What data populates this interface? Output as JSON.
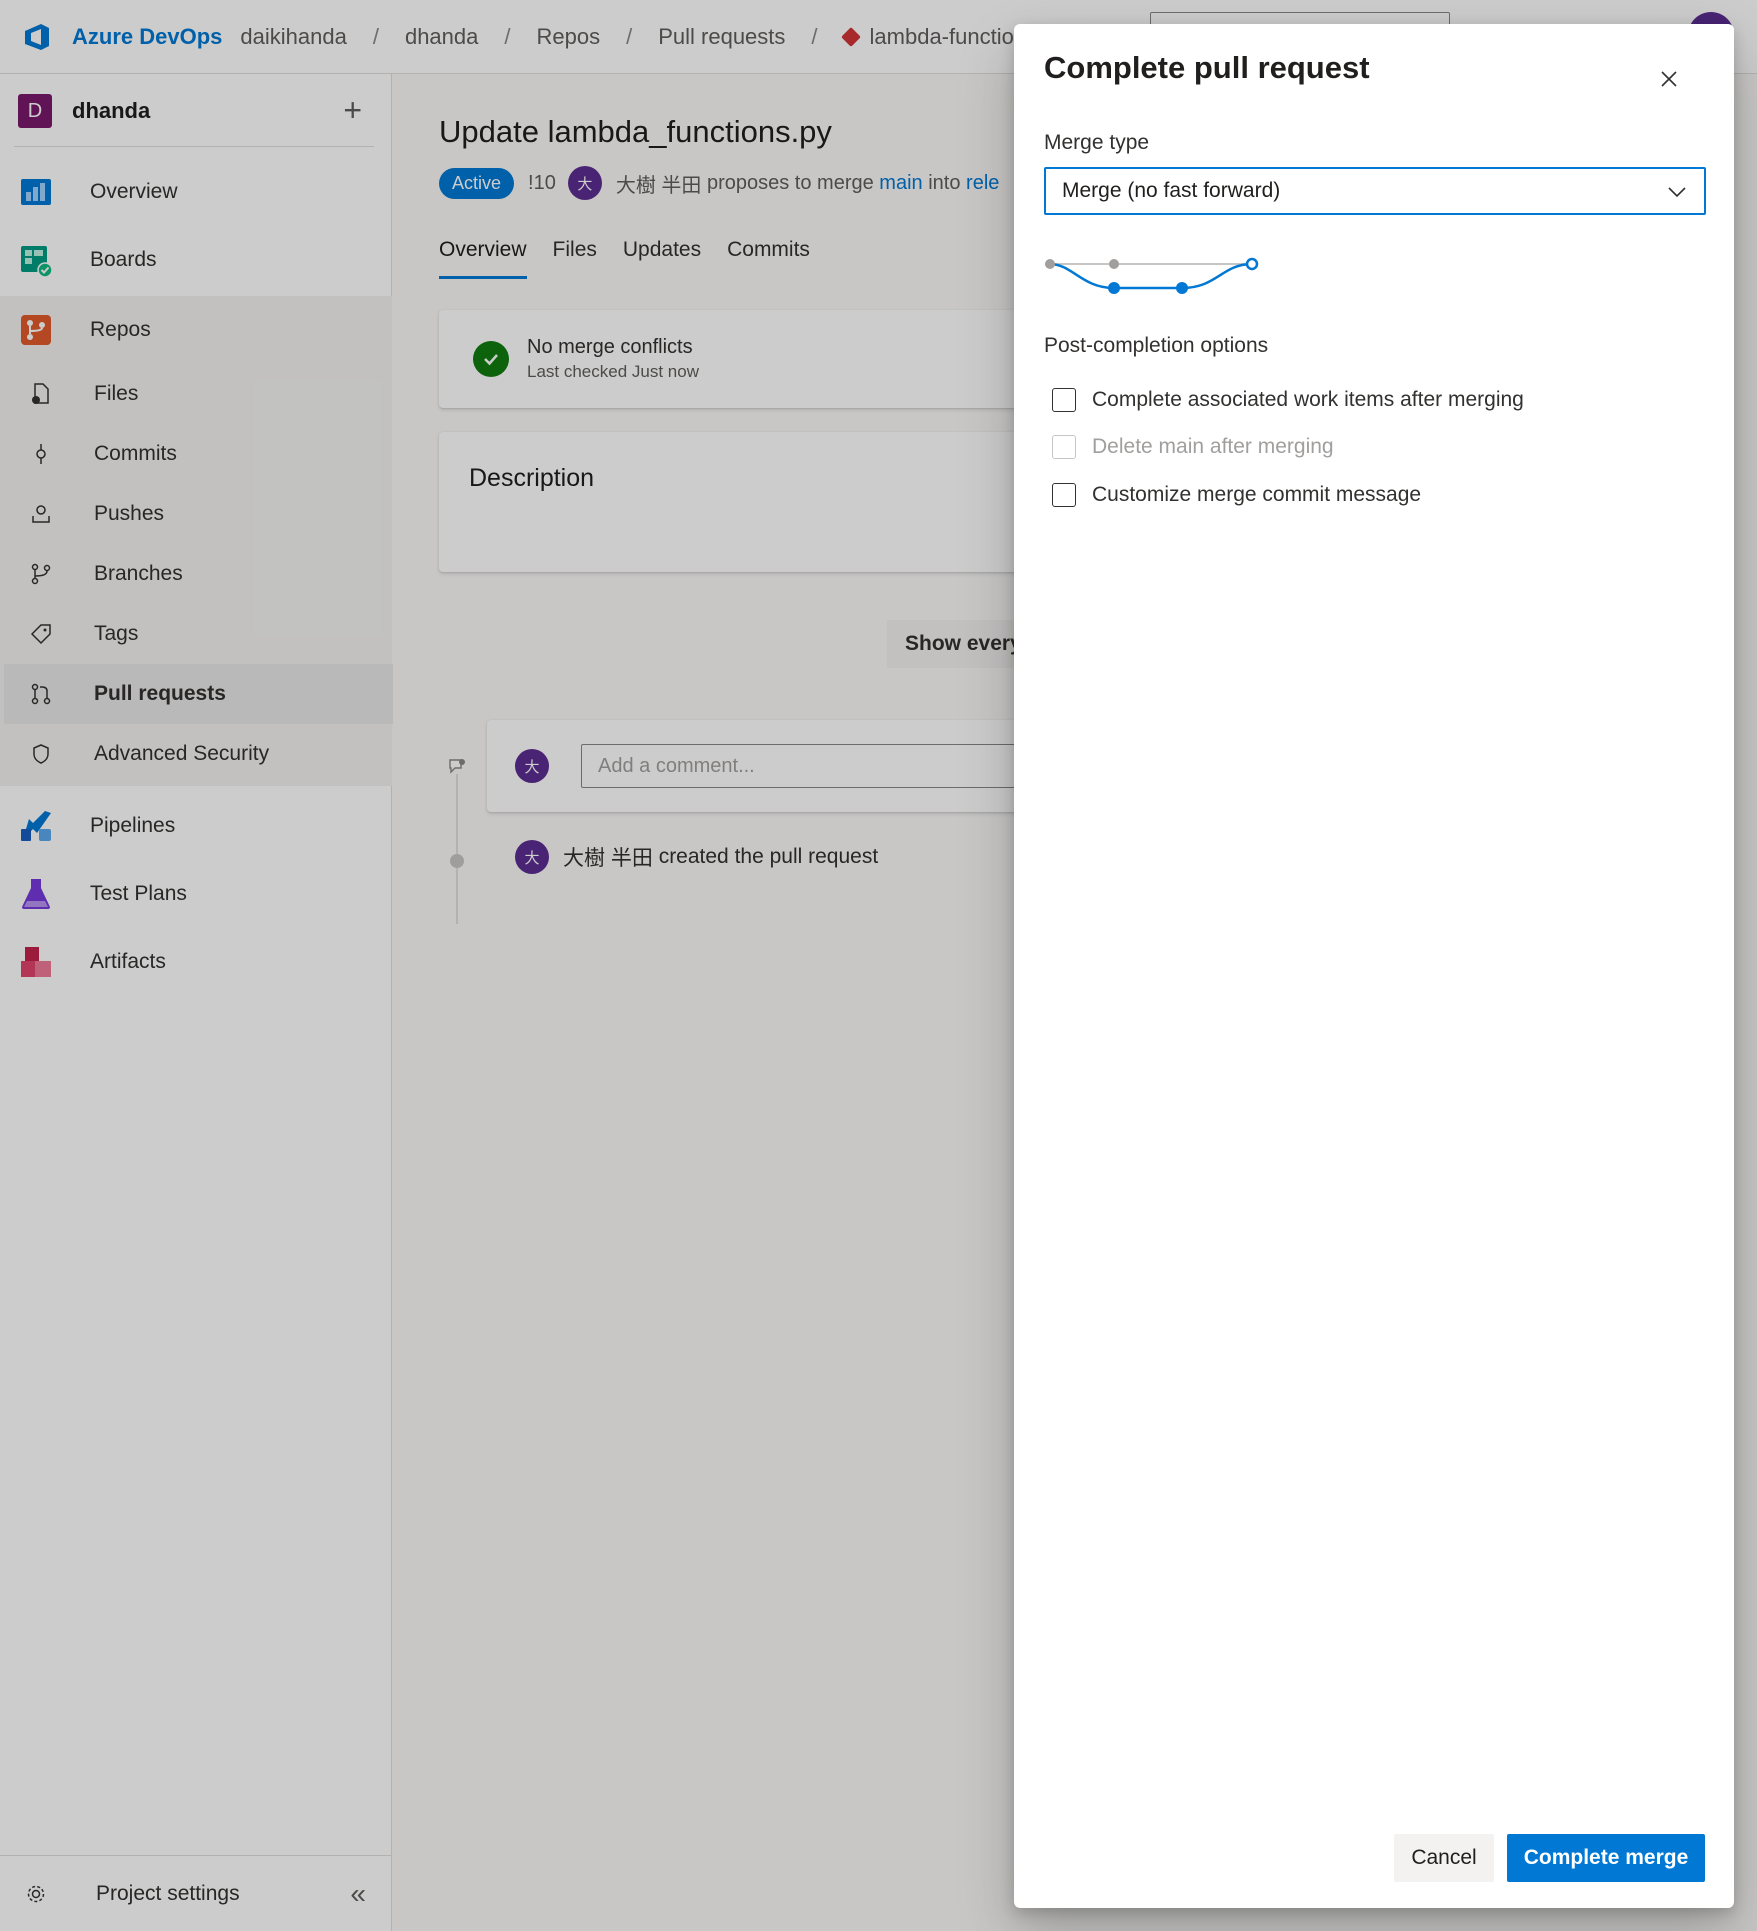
{
  "topbar": {
    "brand": "Azure DevOps",
    "breadcrumbs": [
      "daikihanda",
      "dhanda",
      "Repos",
      "Pull requests"
    ],
    "separator": "/",
    "repo": "lambda-functions"
  },
  "sidebar": {
    "project_initial": "D",
    "project_name": "dhanda",
    "add_label": "+",
    "items": [
      {
        "label": "Overview",
        "icon": "overview-icon"
      },
      {
        "label": "Boards",
        "icon": "boards-icon"
      },
      {
        "label": "Repos",
        "icon": "repos-icon"
      },
      {
        "label": "Files",
        "icon": "files-icon"
      },
      {
        "label": "Commits",
        "icon": "commits-icon"
      },
      {
        "label": "Pushes",
        "icon": "pushes-icon"
      },
      {
        "label": "Branches",
        "icon": "branches-icon"
      },
      {
        "label": "Tags",
        "icon": "tags-icon"
      },
      {
        "label": "Pull requests",
        "icon": "pull-requests-icon"
      },
      {
        "label": "Advanced Security",
        "icon": "shield-icon"
      },
      {
        "label": "Pipelines",
        "icon": "pipelines-icon"
      },
      {
        "label": "Test Plans",
        "icon": "test-plans-icon"
      },
      {
        "label": "Artifacts",
        "icon": "artifacts-icon"
      }
    ],
    "settings_label": "Project settings",
    "collapse_glyph": "«"
  },
  "pr": {
    "title": "Update lambda_functions.py",
    "status": "Active",
    "id": "!10",
    "author_initial": "大",
    "author": "大樹 半田",
    "proposes_text": "proposes to merge",
    "source_branch": "main",
    "into_text": "into",
    "target_branch_partial": "rele",
    "tabs": [
      "Overview",
      "Files",
      "Updates",
      "Commits"
    ],
    "merge_status_title": "No merge conflicts",
    "merge_status_sub": "Last checked Just now",
    "description_heading": "Description",
    "show_button_partial": "Show every",
    "comment_placeholder": "Add a comment...",
    "created_text": "created the pull request"
  },
  "dialog": {
    "title": "Complete pull request",
    "merge_type_label": "Merge type",
    "merge_type_value": "Merge (no fast forward)",
    "post_completion_label": "Post-completion options",
    "options": [
      {
        "label": "Complete associated work items after merging",
        "checked": false,
        "disabled": false
      },
      {
        "label": "Delete main after merging",
        "checked": false,
        "disabled": true
      },
      {
        "label": "Customize merge commit message",
        "checked": false,
        "disabled": false
      }
    ],
    "cancel_label": "Cancel",
    "complete_label": "Complete merge"
  },
  "colors": {
    "accent": "#0078d4",
    "success": "#107c10",
    "avatar": "#5c2d91",
    "project_avatar": "#7a1a6b"
  }
}
